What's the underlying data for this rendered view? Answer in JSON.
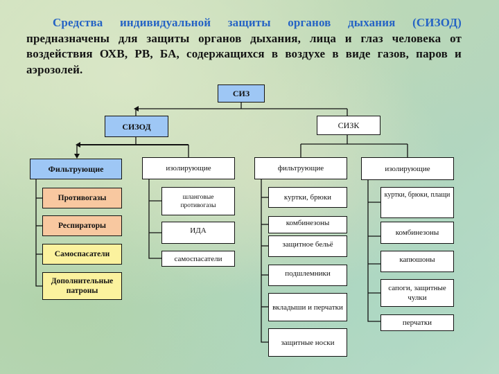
{
  "intro": {
    "lead": "Средства индивидуальной защиты органов дыхания (СИЗОД)",
    "rest": "предназначены для защиты органов дыхания, лица и глаз человека от воздействия ОХВ, РВ, БА, содержащихся в воздухе в виде газов, паров и аэрозолей."
  },
  "colors": {
    "blue_box": "#9ec7f5",
    "orange_box": "#f8c8a0",
    "yellow_box": "#fbf29e",
    "lead_text": "#2563c4"
  },
  "tree": {
    "root": "СИЗ",
    "sizod": {
      "label": "СИЗОД",
      "filtering": {
        "label": "Фильтрующие",
        "items": [
          "Противогазы",
          "Респираторы",
          "Самоспасатели",
          "Дополнительные патроны"
        ]
      },
      "isolating": {
        "label": "изолирующие",
        "items": [
          "шланговые противогазы",
          "ИДА",
          "самоспасатели"
        ]
      }
    },
    "sizk": {
      "label": "СИЗК",
      "filtering": {
        "label": "фильтрующие",
        "items": [
          "куртки, брюки",
          "комбинезоны",
          "защитное бельё",
          "подшлемники",
          "вкладыши и перчатки",
          "защитные носки"
        ]
      },
      "isolating": {
        "label": "изолирующие",
        "items": [
          "куртки, брюки, плащи",
          "комбинезоны",
          "капюшоны",
          "сапоги, защитные чулки",
          "перчатки"
        ]
      }
    }
  }
}
